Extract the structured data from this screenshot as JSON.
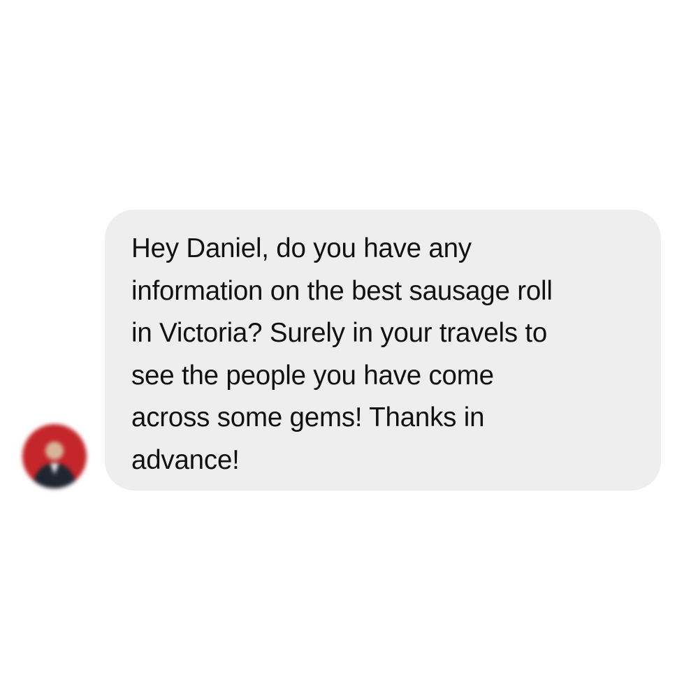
{
  "conversation": {
    "incoming_message": {
      "text": "Hey Daniel, do you have any\ninformation on the best sausage roll\nin Victoria? Surely in your travels to\nsee the people you have come\nacross some gems! Thanks in\nadvance!",
      "bubble_color": "#efeeef",
      "text_color": "#111111"
    },
    "sender_avatar": {
      "icon": "user-avatar",
      "background_color": "#c4262a"
    }
  }
}
